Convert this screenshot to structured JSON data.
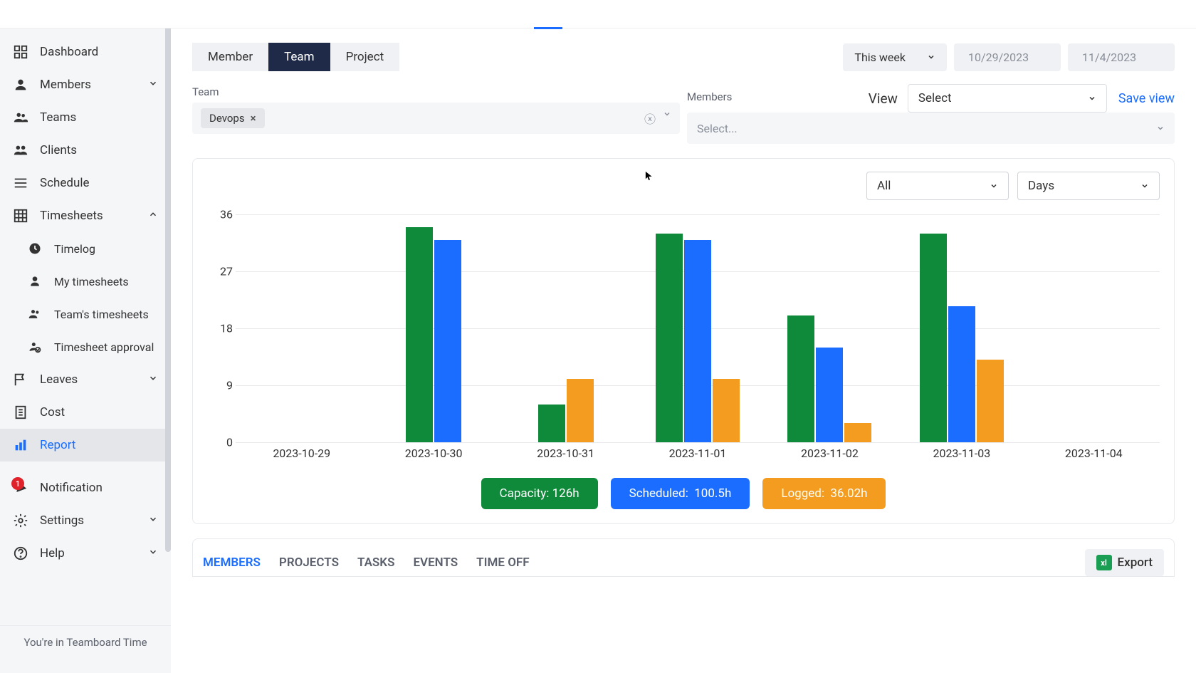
{
  "sidebar": {
    "items": [
      {
        "label": "Dashboard"
      },
      {
        "label": "Members"
      },
      {
        "label": "Teams"
      },
      {
        "label": "Clients"
      },
      {
        "label": "Schedule"
      },
      {
        "label": "Timesheets"
      },
      {
        "label": "Timelog"
      },
      {
        "label": "My timesheets"
      },
      {
        "label": "Team's timesheets"
      },
      {
        "label": "Timesheet approval"
      },
      {
        "label": "Leaves"
      },
      {
        "label": "Cost"
      },
      {
        "label": "Report"
      },
      {
        "label": "Notification"
      },
      {
        "label": "Settings"
      },
      {
        "label": "Help"
      }
    ],
    "notification_badge": "1",
    "footer": "You're in Teamboard Time"
  },
  "tabs": {
    "member": "Member",
    "team": "Team",
    "project": "Project"
  },
  "date_range": {
    "preset": "This week",
    "start": "10/29/2023",
    "end": "11/4/2023"
  },
  "filters": {
    "team_label": "Team",
    "team_chip": "Devops",
    "members_label": "Members",
    "members_placeholder": "Select...",
    "view_label": "View",
    "view_value": "Select",
    "save": "Save view"
  },
  "chart_controls": {
    "series_filter": "All",
    "granularity": "Days"
  },
  "chart_data": {
    "type": "bar",
    "categories": [
      "2023-10-29",
      "2023-10-30",
      "2023-10-31",
      "2023-11-01",
      "2023-11-02",
      "2023-11-03",
      "2023-11-04"
    ],
    "series": [
      {
        "name": "Capacity",
        "values": [
          0,
          34,
          6,
          33,
          20,
          33,
          0
        ]
      },
      {
        "name": "Scheduled",
        "values": [
          0,
          32,
          0,
          32,
          15,
          21.5,
          0
        ]
      },
      {
        "name": "Logged",
        "values": [
          0,
          0,
          10,
          10,
          3,
          13,
          0
        ]
      }
    ],
    "ylim": [
      0,
      36
    ],
    "yticks": [
      0,
      9,
      18,
      27,
      36
    ],
    "ylabel": "",
    "xlabel": "",
    "title": ""
  },
  "legend": {
    "capacity_label": "Capacity:",
    "capacity_value": "126h",
    "scheduled_label": "Scheduled:",
    "scheduled_value": "100.5h",
    "logged_label": "Logged:",
    "logged_value": "36.02h"
  },
  "subtabs": {
    "members": "MEMBERS",
    "projects": "PROJECTS",
    "tasks": "TASKS",
    "events": "EVENTS",
    "timeoff": "TIME OFF",
    "export": "Export"
  }
}
